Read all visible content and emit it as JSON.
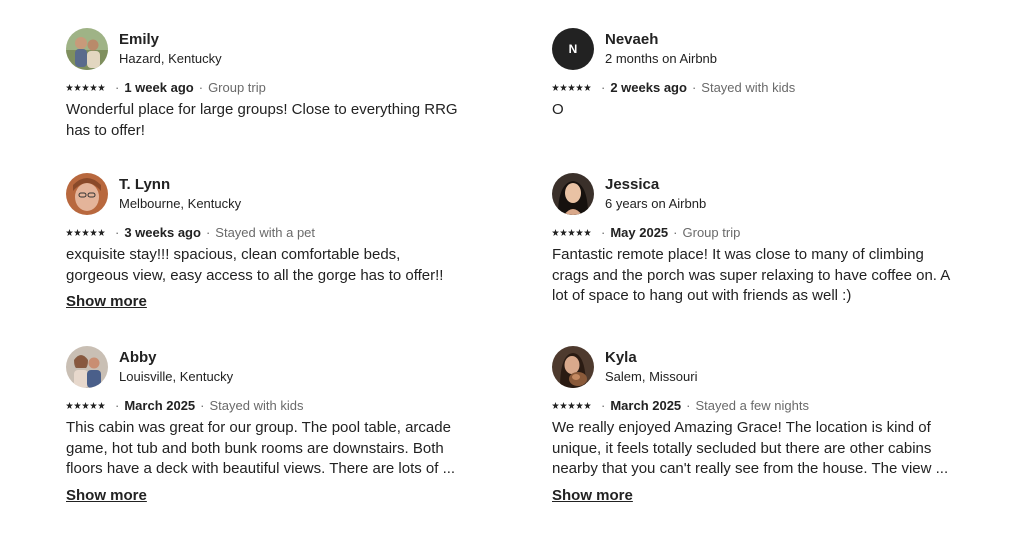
{
  "reviews": [
    {
      "name": "Emily",
      "subtitle": "Hazard, Kentucky",
      "rating": 5,
      "date": "1 week ago",
      "trip": "Group trip",
      "text": "Wonderful place for large groups! Close to everything RRG has to offer!",
      "avatar": "photo"
    },
    {
      "name": "Nevaeh",
      "subtitle": "2 months on Airbnb",
      "rating": 5,
      "date": "2 weeks ago",
      "trip": "Stayed with kids",
      "text": "O",
      "avatar_initial": "N"
    },
    {
      "name": "T. Lynn",
      "subtitle": "Melbourne, Kentucky",
      "rating": 5,
      "date": "3 weeks ago",
      "trip": "Stayed with a pet",
      "text": "exquisite stay!!!  spacious, clean comfortable beds, gorgeous view, easy access to all the gorge has to offer!!",
      "show_more": "Show more",
      "avatar": "photo"
    },
    {
      "name": "Jessica",
      "subtitle": "6 years on Airbnb",
      "rating": 5,
      "date": "May 2025",
      "trip": "Group trip",
      "text": "Fantastic remote place! It was close to many of climbing crags and the porch was super relaxing to have coffee on. A lot of space to hang out with friends as well :)",
      "avatar": "photo"
    },
    {
      "name": "Abby",
      "subtitle": "Louisville, Kentucky",
      "rating": 5,
      "date": "March 2025",
      "trip": "Stayed with kids",
      "text": "This cabin was great for our group.  The pool table, arcade game, hot tub and both bunk rooms are downstairs.  Both floors have a deck with beautiful views.  There are lots of ...",
      "show_more": "Show more",
      "avatar": "photo"
    },
    {
      "name": "Kyla",
      "subtitle": "Salem, Missouri",
      "rating": 5,
      "date": "March 2025",
      "trip": "Stayed a few nights",
      "text": "We really enjoyed Amazing Grace! The location is kind of unique, it feels totally secluded but there are other cabins nearby that you can't really see from the house. The view ...",
      "show_more": "Show more",
      "avatar": "photo"
    }
  ]
}
